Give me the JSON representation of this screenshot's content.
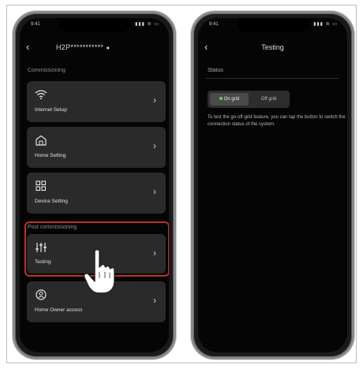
{
  "left_screen": {
    "status_time": "9:41",
    "status_icons": "▮▮▮ ≋ ▭",
    "back_icon": "chevron-left-icon",
    "title": "H2P***********",
    "title_icon": "speaker-icon",
    "commissioning_label": "Commissioning",
    "items": [
      {
        "label": "Internet Setup",
        "icon": "wifi-icon"
      },
      {
        "label": "Home Setting",
        "icon": "home-icon"
      },
      {
        "label": "Device Setting",
        "icon": "grid-icon"
      }
    ],
    "post_commissioning_label": "Post commissioning",
    "post_items": [
      {
        "label": "Testing",
        "icon": "sliders-icon"
      },
      {
        "label": "Home Owner access",
        "icon": "user-circle-icon"
      }
    ],
    "highlight_color": "#c0302a"
  },
  "right_screen": {
    "status_time": "9:41",
    "status_icons": "▮▮▮ ≋ ▭",
    "back_icon": "chevron-left-icon",
    "title": "Testing",
    "status_label": "Status",
    "toggle": {
      "on_grid": "On grid",
      "off_grid": "Off grid",
      "selected": "On grid"
    },
    "description": "To test the go-off-grid feature, you can tap the button to switch the connection status of the system."
  }
}
